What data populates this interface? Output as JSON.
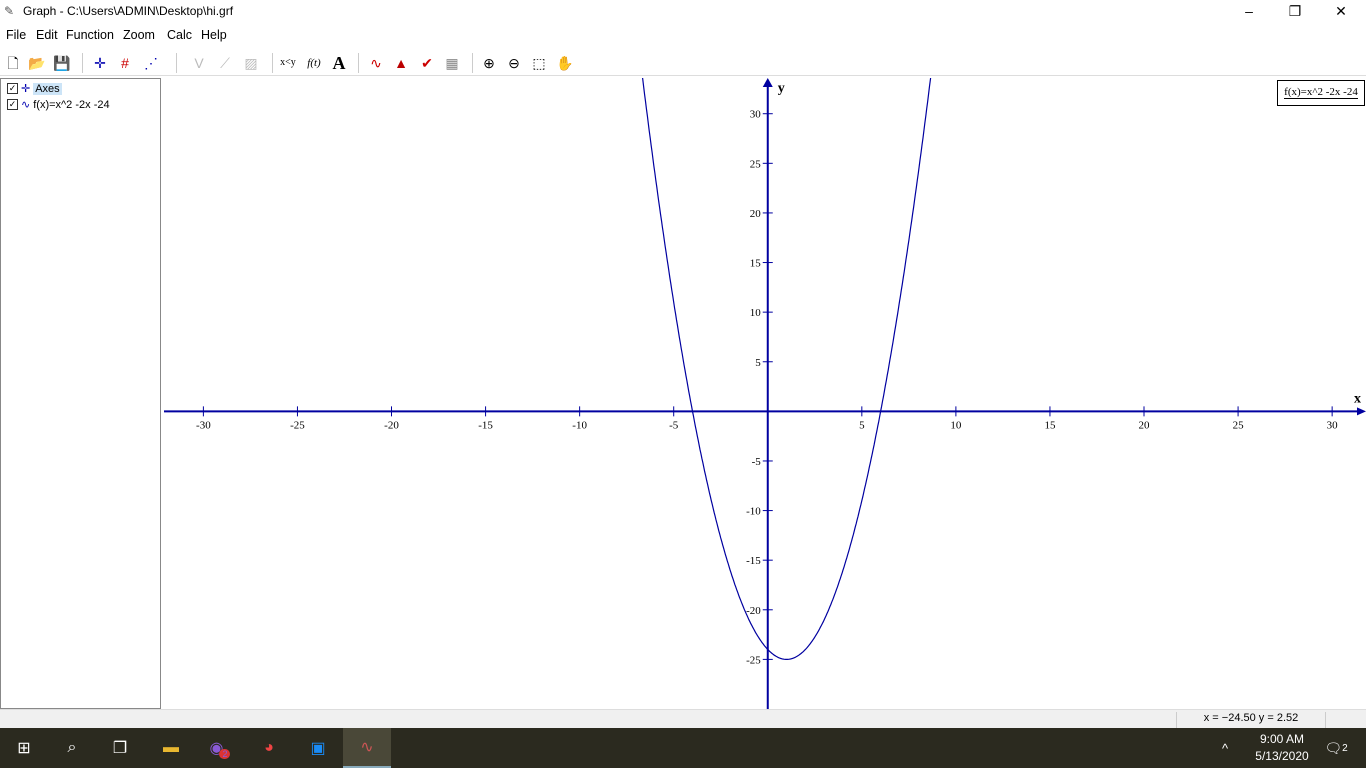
{
  "window": {
    "title": "Graph - C:\\Users\\ADMIN\\Desktop\\hi.grf"
  },
  "menu": [
    "File",
    "Edit",
    "Function",
    "Zoom",
    "Calc",
    "Help"
  ],
  "toolbar": {
    "xy_label": "x<y",
    "fx_label": "f(t)",
    "text_label": "A"
  },
  "panel": {
    "items": [
      {
        "label": "Axes",
        "checked": true,
        "selected": true
      },
      {
        "label": "f(x)=x^2 -2x -24",
        "checked": true
      }
    ]
  },
  "legend": {
    "label": "f(x)=x^2 -2x -24"
  },
  "status": {
    "coords": "x = −24.50    y = 2.52"
  },
  "taskbar": {
    "time": "9:00 AM",
    "date": "5/13/2020",
    "notifications": "2",
    "viber_badge": "2"
  },
  "chart_data": {
    "type": "line",
    "function": "x^2-2x-24",
    "xlabel": "x",
    "ylabel": "y",
    "xlim": [
      -32.2,
      31.8
    ],
    "ylim": [
      -30,
      33.6
    ],
    "xticks": [
      -30,
      -25,
      -20,
      -15,
      -10,
      -5,
      5,
      10,
      15,
      20,
      25,
      30
    ],
    "yticks": [
      -25,
      -20,
      -15,
      -10,
      -5,
      5,
      10,
      15,
      20,
      25,
      30
    ],
    "color": "#0000a0"
  }
}
